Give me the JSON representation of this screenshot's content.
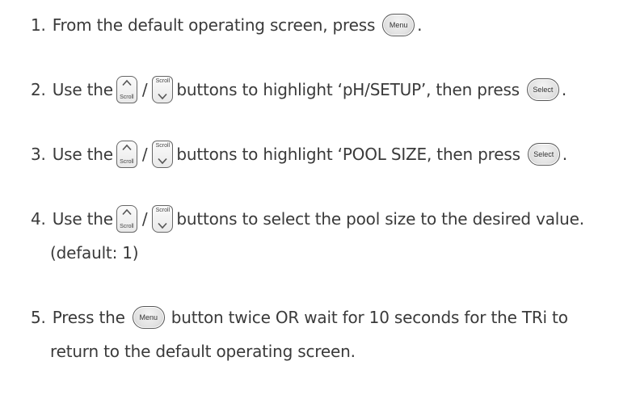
{
  "steps": [
    {
      "number": "1.",
      "text_a": "From the default operating screen, press",
      "menu_label": "Menu",
      "text_end": "."
    },
    {
      "number": "2.",
      "text_a": "Use the",
      "scroll_up_label": "Scroll",
      "slash": "/",
      "scroll_down_label": "Scroll",
      "text_b": "buttons to highlight ‘pH/SETUP’, then press",
      "select_label": "Select",
      "text_end": "."
    },
    {
      "number": "3.",
      "text_a": "Use the",
      "scroll_up_label": "Scroll",
      "slash": "/",
      "scroll_down_label": "Scroll",
      "text_b": "buttons to highlight ‘POOL SIZE, then press",
      "select_label": "Select",
      "text_end": "."
    },
    {
      "number": "4.",
      "text_a": "Use the",
      "scroll_up_label": "Scroll",
      "slash": "/",
      "scroll_down_label": "Scroll",
      "text_b": "buttons to select the pool size to the desired value.",
      "text_line2": "(default: 1)"
    },
    {
      "number": "5.",
      "text_a": "Press the",
      "menu_label": "Menu",
      "text_b": "button twice OR wait for 10 seconds for the TRi to",
      "text_line2": "return to the default operating screen."
    }
  ]
}
